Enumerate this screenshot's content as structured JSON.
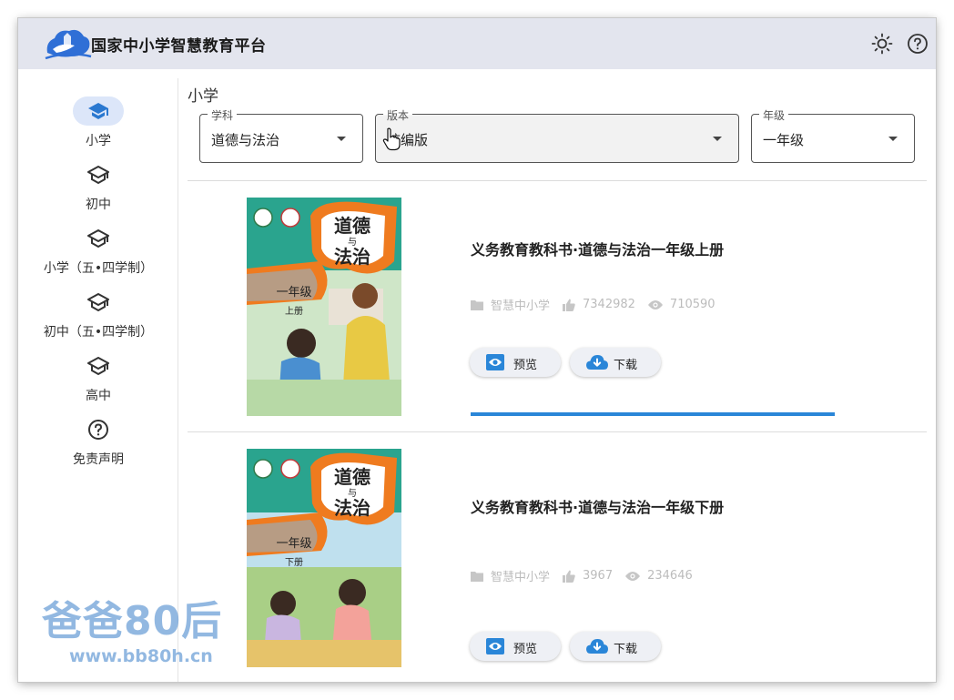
{
  "app": {
    "title": "国家中小学智慧教育平台"
  },
  "header": {
    "icons": [
      "sun-icon",
      "help-icon"
    ]
  },
  "sidebar": {
    "items": [
      {
        "label": "小学",
        "icon": "graduation-cap-icon",
        "active": true
      },
      {
        "label": "初中",
        "icon": "graduation-cap-icon",
        "active": false
      },
      {
        "label": "小学（五•四学制）",
        "icon": "graduation-cap-icon",
        "active": false
      },
      {
        "label": "初中（五•四学制）",
        "icon": "graduation-cap-icon",
        "active": false
      },
      {
        "label": "高中",
        "icon": "graduation-cap-icon",
        "active": false
      },
      {
        "label": "免责声明",
        "icon": "help-icon",
        "active": false
      }
    ]
  },
  "main": {
    "section_title": "小学",
    "filters": [
      {
        "legend": "学科",
        "value": "道德与法治"
      },
      {
        "legend": "版本",
        "value": "统编版"
      },
      {
        "legend": "年级",
        "value": "一年级"
      }
    ],
    "books": [
      {
        "title": "义务教育教科书·道德与法治一年级上册",
        "publisher": "智慧中小学",
        "likes": "7342982",
        "views": "710590",
        "cover_title_1": "道德",
        "cover_title_2": "与",
        "cover_title_3": "法治",
        "cover_grade": "一年级",
        "cover_volume": "上册",
        "preview_label": "预览",
        "download_label": "下载",
        "download_progress": 1.0
      },
      {
        "title": "义务教育教科书·道德与法治一年级下册",
        "publisher": "智慧中小学",
        "likes": "3967",
        "views": "234646",
        "cover_title_1": "道德",
        "cover_title_2": "与",
        "cover_title_3": "法治",
        "cover_grade": "一年级",
        "cover_volume": "下册",
        "preview_label": "预览",
        "download_label": "下载"
      }
    ]
  },
  "watermark": {
    "text": "爸爸80后",
    "url": "www.bb80h.cn"
  },
  "colors": {
    "accent": "#2a86d8",
    "header_bg": "#e3e5ee",
    "nav_active_bg": "#dce6f9"
  }
}
